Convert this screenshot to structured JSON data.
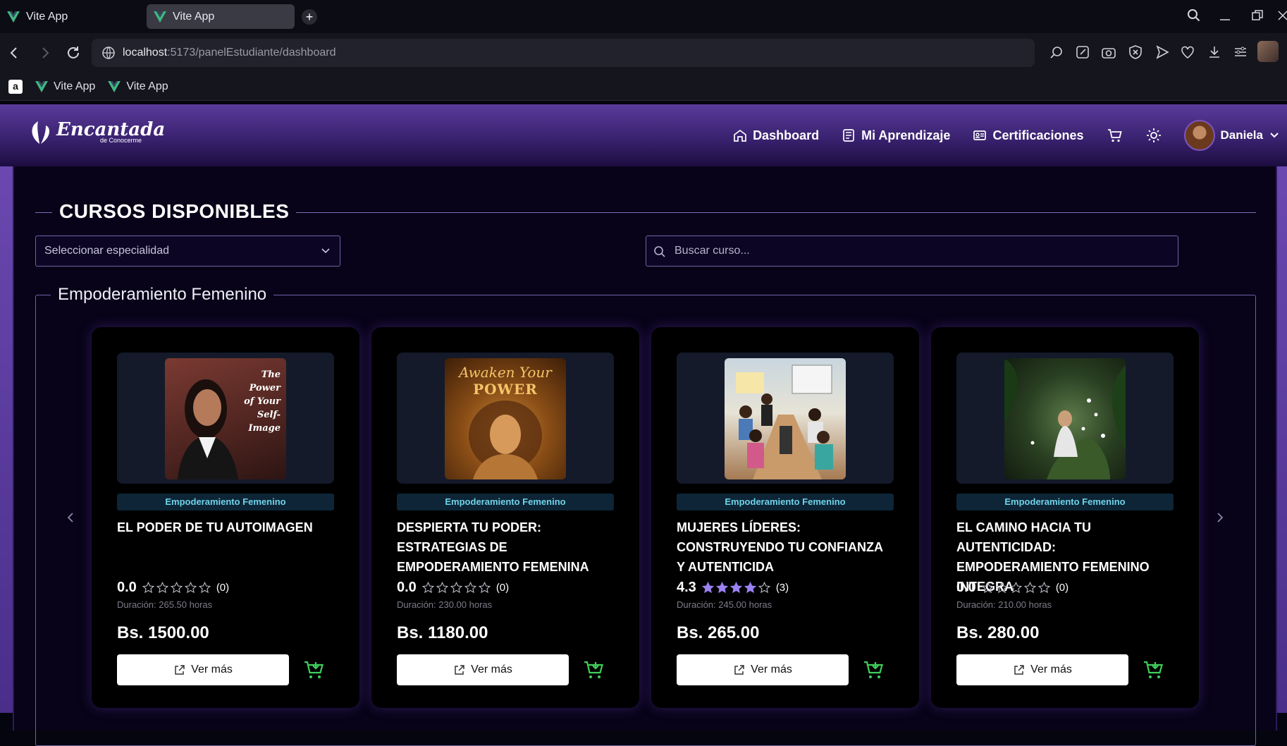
{
  "browser": {
    "tabs": [
      {
        "label": "Vite App",
        "active": false
      },
      {
        "label": "Vite App",
        "active": true
      }
    ],
    "url_host": "localhost",
    "url_path": ":5173/panelEstudiante/dashboard",
    "bookmarks": [
      {
        "label": "Vite App"
      },
      {
        "label": "Vite App"
      }
    ]
  },
  "header": {
    "brand_name": "Encantada",
    "brand_sub": "de Conocerme",
    "nav": [
      {
        "label": "Dashboard",
        "icon": "home-icon"
      },
      {
        "label": "Mi Aprendizaje",
        "icon": "book-icon"
      },
      {
        "label": "Certificaciones",
        "icon": "id-card-icon"
      }
    ],
    "user_name": "Daniela"
  },
  "main": {
    "section_title": "CURSOS DISPONIBLES",
    "specialty_placeholder": "Seleccionar especialidad",
    "search_placeholder": "Buscar curso...",
    "group_title": "Empoderamiento Femenino"
  },
  "colors": {
    "accent": "#6e3fc4",
    "tag_text": "#6fd3ea",
    "star_filled": "#9b82f2",
    "cart_green": "#3ecf5a"
  },
  "courses": [
    {
      "category": "Empoderamiento Femenino",
      "title": "EL PODER DE TU AUTOIMAGEN",
      "rating": "0.0",
      "rating_value": 0,
      "reviews": "(0)",
      "duration": "Duración: 265.50 horas",
      "price": "Bs. 1500.00",
      "button": "Ver más",
      "image_text_1": "The Power",
      "image_text_2": "of Your",
      "image_text_3": "Self-Image"
    },
    {
      "category": "Empoderamiento Femenino",
      "title": "DESPIERTA TU PODER: ESTRATEGIAS DE EMPODERAMIENTO FEMENINA",
      "rating": "0.0",
      "rating_value": 0,
      "reviews": "(0)",
      "duration": "Duración: 230.00 horas",
      "price": "Bs. 1180.00",
      "button": "Ver más",
      "image_text_1": "Awaken Your",
      "image_text_2": "POWER"
    },
    {
      "category": "Empoderamiento Femenino",
      "title": "MUJERES LÍDERES: CONSTRUYENDO TU CONFIANZA Y AUTENTICIDA",
      "rating": "4.3",
      "rating_value": 4,
      "reviews": "(3)",
      "duration": "Duración: 245.00 horas",
      "price": "Bs. 265.00",
      "button": "Ver más"
    },
    {
      "category": "Empoderamiento Femenino",
      "title": "EL CAMINO HACIA TU AUTENTICIDAD: EMPODERAMIENTO FEMENINO INTEGRA",
      "rating": "0.0",
      "rating_value": 0,
      "reviews": "(0)",
      "duration": "Duración: 210.00 horas",
      "price": "Bs. 280.00",
      "button": "Ver más"
    }
  ]
}
